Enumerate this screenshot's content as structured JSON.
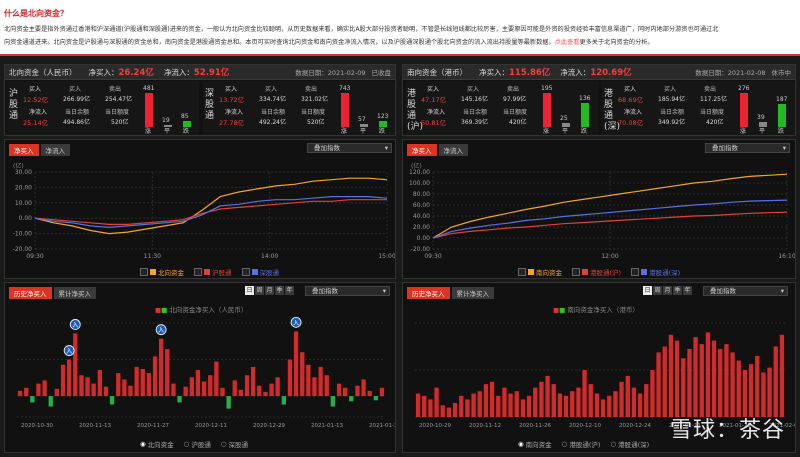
{
  "intro": {
    "title": "什么是北向资金？",
    "line1": "北向资金主要是指外资通过香港和沪深通道(沪股通和深股通)进来的资金，一般认为北向资金比较聪明，从历史数据来看，确实比A股大部分投资者聪明，不管是长线短线都比较厉害，主要原因可能是外资的投资经验丰富信息渠道广，同时内地部分游资也可通过北",
    "line2": "向资金通道进来。北向资金是沪股通与深股通的资金总和，南向资金是港股通资金总和。本页可实时查询北向资金和南向资金净流入情况，以及沪股通深股通个股北向资金的流入流出持股量等最新数据。",
    "link": "点此查看",
    "tail": "更多关于北向资金的分析。"
  },
  "north": {
    "title": "北向资金（人民币）",
    "net_buy_label": "净买入：",
    "net_buy": "26.24亿",
    "net_inflow_label": "净流入：",
    "net_inflow": "52.91亿",
    "date": "数据日期：2021-02-09",
    "status": "已收盘",
    "hgt": {
      "name": "沪股通",
      "buy_label": "买入",
      "buy": "266.99亿",
      "sell_label": "卖出",
      "sell": "254.47亿",
      "net_buy": "12.52亿",
      "net_inflow_label": "净流入",
      "net_inflow": "25.14亿",
      "balance_label": "当日余额",
      "balance": "494.86亿",
      "quota_label": "当日额度",
      "quota": "520亿",
      "up": "481",
      "flat": "19",
      "down": "85",
      "up_label": "涨",
      "flat_label": "平",
      "down_label": "跌",
      "up_ratio": 1.0,
      "flat_ratio": 0.04,
      "down_ratio": 0.18
    },
    "sgt": {
      "name": "深股通",
      "buy_label": "买入",
      "buy": "334.74亿",
      "sell_label": "卖出",
      "sell": "321.02亿",
      "net_buy": "13.72亿",
      "net_inflow_label": "净流入",
      "net_inflow": "27.78亿",
      "balance_label": "当日余额",
      "balance": "492.24亿",
      "quota_label": "当日额度",
      "quota": "520亿",
      "up": "743",
      "flat": "57",
      "down": "123",
      "up_label": "涨",
      "flat_label": "平",
      "down_label": "跌",
      "up_ratio": 1.0,
      "flat_ratio": 0.08,
      "down_ratio": 0.17
    }
  },
  "south": {
    "title": "南向资金（港币）",
    "net_buy_label": "净买入：",
    "net_buy": "115.86亿",
    "net_inflow_label": "净流入：",
    "net_inflow": "120.69亿",
    "date": "数据日期：2021-02-08",
    "status": "休市中",
    "hk_sh": {
      "name": "港股通(沪)",
      "buy_label": "买入",
      "buy": "145.16亿",
      "sell_label": "卖出",
      "sell": "97.99亿",
      "net_buy": "47.17亿",
      "net_inflow_label": "净流入",
      "net_inflow": "50.81亿",
      "balance_label": "当日余额",
      "balance": "369.39亿",
      "quota_label": "当日额度",
      "quota": "420亿",
      "up": "195",
      "flat": "25",
      "down": "136",
      "up_label": "涨",
      "flat_label": "平",
      "down_label": "跌",
      "up_ratio": 1.0,
      "flat_ratio": 0.13,
      "down_ratio": 0.7
    },
    "hk_sz": {
      "name": "港股通(深)",
      "buy_label": "买入",
      "buy": "185.94亿",
      "sell_label": "卖出",
      "sell": "117.25亿",
      "net_buy": "68.69亿",
      "net_inflow_label": "净流入",
      "net_inflow": "70.08亿",
      "balance_label": "当日余额",
      "balance": "349.92亿",
      "quota_label": "当日额度",
      "quota": "420亿",
      "up": "276",
      "flat": "39",
      "down": "187",
      "up_label": "涨",
      "flat_label": "平",
      "down_label": "跌",
      "up_ratio": 1.0,
      "flat_ratio": 0.14,
      "down_ratio": 0.68
    }
  },
  "ui": {
    "tab_net_buy": "净买入",
    "tab_net_inflow": "净流入",
    "tab_hist_net_buy": "历史净买入",
    "tab_cum_net_buy": "累计净买入",
    "overlay_index": "叠加指数",
    "range_day": "日",
    "range_week": "周",
    "range_month": "月",
    "range_quarter": "季",
    "range_year": "年",
    "unit": "(亿)",
    "watermark": "雪球：茶谷"
  },
  "colors": {
    "red": "#ff3b3b",
    "green": "#22c25a",
    "north_total": "#f5a623",
    "hgt": "#e0413a",
    "sgt": "#5b6fe0",
    "grid": "#2c2c2c"
  },
  "chart_data": [
    {
      "type": "line",
      "title": "",
      "x_ticks": [
        "09:30",
        "11:30",
        "14:00",
        "15:00"
      ],
      "y_ticks": [
        "30.00",
        "20.00",
        "10.00",
        "0.00",
        "-10.00",
        "-20.00"
      ],
      "ylim": [
        -20,
        30
      ],
      "legend": [
        "北向资金",
        "沪股通",
        "深股通"
      ],
      "series": [
        {
          "name": "北向资金",
          "values": [
            0,
            -3,
            -5,
            -8,
            -10,
            -9,
            -7,
            -5,
            -3,
            5,
            14,
            17,
            19,
            21,
            22,
            24,
            25,
            26,
            26,
            25
          ]
        },
        {
          "name": "沪股通",
          "values": [
            0,
            -1,
            -2,
            -3,
            -4,
            -4,
            -3,
            -2,
            -1,
            3,
            6,
            7,
            8,
            9,
            10,
            11,
            11,
            12,
            12,
            12
          ]
        },
        {
          "name": "深股通",
          "values": [
            0,
            -2,
            -3,
            -5,
            -6,
            -5,
            -4,
            -3,
            -2,
            2,
            8,
            9,
            11,
            12,
            12,
            13,
            14,
            14,
            14,
            13
          ]
        }
      ]
    },
    {
      "type": "line",
      "title": "",
      "x_ticks": [
        "09:30",
        "12:00",
        "16:10"
      ],
      "y_ticks": [
        "120.00",
        "100.00",
        "80.00",
        "60.00",
        "40.00",
        "20.00",
        "0.00",
        "-20.00"
      ],
      "ylim": [
        -20,
        120
      ],
      "legend": [
        "南向资金",
        "港股通(沪)",
        "港股通(深)"
      ],
      "series": [
        {
          "name": "南向资金",
          "values": [
            0,
            20,
            30,
            38,
            45,
            52,
            58,
            65,
            70,
            75,
            80,
            85,
            90,
            95,
            100,
            103,
            108,
            112,
            114,
            116
          ]
        },
        {
          "name": "港股通(沪)",
          "values": [
            0,
            8,
            12,
            15,
            18,
            20,
            23,
            26,
            28,
            30,
            32,
            34,
            36,
            38,
            40,
            41,
            43,
            45,
            46,
            47
          ]
        },
        {
          "name": "港股通(深)",
          "values": [
            0,
            12,
            18,
            23,
            27,
            32,
            35,
            39,
            42,
            45,
            48,
            51,
            54,
            57,
            60,
            62,
            65,
            67,
            68,
            69
          ]
        }
      ]
    },
    {
      "type": "bar",
      "title": "",
      "legend": "北向资金净买入（人民币）",
      "x_ticks": [
        "2020-10-30",
        "2020-11-13",
        "2020-11-27",
        "2020-12-11",
        "2020-12-29",
        "2021-01-13",
        "2021-01-27"
      ],
      "values": [
        5,
        8,
        -6,
        12,
        15,
        -10,
        7,
        30,
        35,
        60,
        20,
        18,
        12,
        25,
        9,
        -8,
        22,
        16,
        10,
        28,
        26,
        22,
        38,
        55,
        45,
        12,
        -6,
        9,
        18,
        25,
        14,
        20,
        33,
        8,
        -12,
        15,
        6,
        20,
        28,
        10,
        4,
        12,
        18,
        -8,
        35,
        62,
        42,
        30,
        18,
        28,
        20,
        -10,
        12,
        8,
        -5,
        10,
        16,
        5,
        -4,
        8
      ],
      "annotations": [
        "入",
        "入",
        "入",
        "入"
      ]
    },
    {
      "type": "bar",
      "title": "",
      "legend": "南向资金净买入（港币）",
      "x_ticks": [
        "2020-10-29",
        "2020-11-12",
        "2020-11-26",
        "2020-12-10",
        "2020-12-24",
        "2021-01-11",
        "2021-01-25",
        "2021-02-08"
      ],
      "values": [
        20,
        18,
        15,
        25,
        10,
        8,
        12,
        18,
        15,
        20,
        22,
        28,
        30,
        18,
        25,
        20,
        22,
        15,
        18,
        25,
        30,
        35,
        28,
        20,
        18,
        22,
        25,
        40,
        28,
        20,
        15,
        18,
        22,
        30,
        35,
        25,
        20,
        28,
        40,
        55,
        60,
        70,
        65,
        50,
        58,
        68,
        62,
        72,
        65,
        58,
        62,
        55,
        48,
        40,
        45,
        52,
        38,
        42,
        60,
        70
      ]
    }
  ]
}
